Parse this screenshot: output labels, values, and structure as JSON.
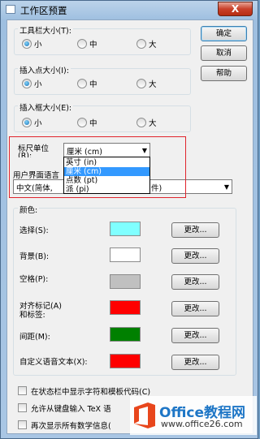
{
  "window": {
    "title": "工作区预置",
    "close_label": "X"
  },
  "buttons": {
    "ok": "确定",
    "cancel": "取消",
    "help": "帮助"
  },
  "toolbar_size": {
    "label": "工具栏大小(T):",
    "options": [
      "小",
      "中",
      "大"
    ],
    "selected": "小"
  },
  "insert_point_size": {
    "label": "插入点大小(I):",
    "options": [
      "小",
      "中",
      "大"
    ],
    "selected": "小"
  },
  "insert_box_size": {
    "label": "插入框大小(E):",
    "options": [
      "小",
      "中",
      "大"
    ],
    "selected": "小"
  },
  "ruler_unit": {
    "label": "标尺单位",
    "label_suffix": "(R):",
    "selected": "厘米 (cm)",
    "options": [
      "英寸 (in)",
      "厘米 (cm)",
      "点数 (pt)",
      "派 (pi)"
    ]
  },
  "ui_language": {
    "label": "用户界面语言",
    "value": "中文(简体,",
    "value_tail": "件)"
  },
  "colors": {
    "group_label": "颜色:",
    "change_label": "更改...",
    "items": [
      {
        "label": "选择(S):",
        "color": "#80ffff"
      },
      {
        "label": "背景(B):",
        "color": "#ffffff"
      },
      {
        "label": "空格(P):",
        "color": "#c0c0c0"
      },
      {
        "label": "对齐标记(A)",
        "label2": "和标签:",
        "color": "#ff0000"
      },
      {
        "label": "间距(M):",
        "color": "#008000"
      },
      {
        "label": "自定义语音文本(X):",
        "color": "#ff0000"
      }
    ]
  },
  "checkboxes": [
    {
      "label": "在状态栏中显示字符和模板代码(C)",
      "checked": false
    },
    {
      "label": "允许从键盘输入 TeX 语",
      "checked": false
    },
    {
      "label": "再次显示所有数学信息(",
      "checked": false
    }
  ],
  "watermark": {
    "brand": "Office教程网",
    "url": "www.office26.com"
  }
}
